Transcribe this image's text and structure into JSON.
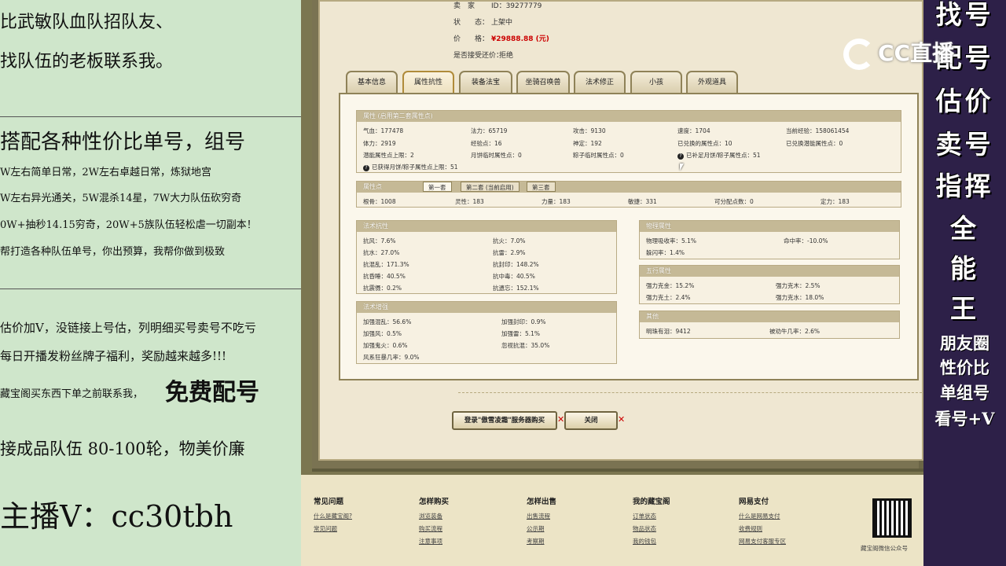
{
  "left": {
    "lines": [
      "比武敏队血队招队友、",
      "找队伍的老板联系我。",
      "搭配各种性价比单号，组号",
      "W左右简单日常，2W左右卓越日常，炼狱地宫",
      "W左右异光通关，5W混杀14星，7W大力队伍砍穷奇",
      "0W+抽秒14.15穷奇，20W+5族队伍轻松虐一切副本！",
      "帮打造各种队伍单号，你出预算，我帮你做到极致",
      "估价加V，没链接上号估，列明细买号卖号不吃亏",
      "每日开播发粉丝牌子福利，奖励越来越多!!!",
      "藏宝阁买东西下单之前联系我，",
      "免费配号",
      "接成品队伍 80-100轮，物美价廉",
      "主播V：cc30tbh"
    ]
  },
  "info": {
    "seller_label": "卖　家",
    "seller_value": "ID：39277779",
    "status_label": "状　　态：",
    "status_value": "上架中",
    "price_label": "价　　格：",
    "price_value": "¥29888.88 (元)",
    "bargain_label": "是否接受还价：",
    "bargain_value": "拒绝"
  },
  "tabs": [
    "基本信息",
    "属性抗性",
    "装备法宝",
    "坐骑召唤兽",
    "法术修正",
    "小孩",
    "外观道具"
  ],
  "attr": {
    "title": "属性 (启用第二套属性点)",
    "cells": [
      "气血：177478",
      "法力：65719",
      "攻击：9130",
      "速度：1704",
      "当前经验：158061454",
      "体力：2919",
      "经验点：16",
      "神定：192",
      "已兑换的属性点：10",
      "已兑换潜能属性点：0",
      "潜能属性点上限：2",
      "月饼临时属性点：0",
      "粽子临时属性点：0",
      "已补足月饼/粽子属性点：51"
    ],
    "bottom": "已获得月饼/粽子属性点上限：51"
  },
  "points": {
    "title": "属性点",
    "subtabs": [
      "第一套",
      "第二套 (当前启用)",
      "第三套"
    ],
    "cells": [
      "根骨：1008",
      "灵性：183",
      "力量：183",
      "敏捷：331",
      "可分配点数：0",
      "定力：183"
    ]
  },
  "resist": {
    "title": "法术抗性",
    "cells": [
      "抗风：7.6%",
      "抗火：7.0%",
      "抗水：27.0%",
      "抗雷：2.9%",
      "抗混乱：171.3%",
      "抗封印：148.2%",
      "抗昏睡：40.5%",
      "抗中毒：40.5%",
      "抗震慑：0.2%",
      "抗遗忘：152.1%"
    ]
  },
  "enhance": {
    "title": "法术增强",
    "cells": [
      "加强混乱：56.6%",
      "加强封印：0.9%",
      "加强风：0.5%",
      "加强雷：5.1%",
      "加强鬼火：0.6%",
      "忽视抗混：35.0%",
      "风系狂暴几率：9.0%"
    ]
  },
  "physical": {
    "title": "物理属性",
    "cells": [
      "物理吸收率：5.1%",
      "命中率：-10.0%",
      "躲闪率：1.4%"
    ]
  },
  "wuxing": {
    "title": "五行属性",
    "cells": [
      "强力克金：15.2%",
      "强力克木：2.5%",
      "强力克土：2.4%",
      "强力克水：18.0%"
    ]
  },
  "other": {
    "title": "其他",
    "cells": [
      "明珠有泪：9412",
      "被劝牛几率：2.6%"
    ]
  },
  "buttons": {
    "login": "登录\"傲雪凌霜\"服务器购买",
    "close": "关闭"
  },
  "footer": {
    "columns": [
      {
        "title": "常见问题",
        "links": [
          "什么是藏宝阁?",
          "常见问题"
        ]
      },
      {
        "title": "怎样购买",
        "links": [
          "浏览装备",
          "购买流程",
          "注意事项"
        ]
      },
      {
        "title": "怎样出售",
        "links": [
          "出售流程",
          "公示期",
          "考察期"
        ]
      },
      {
        "title": "我的藏宝阁",
        "links": [
          "订单状态",
          "物品状态",
          "我的钱包"
        ]
      },
      {
        "title": "网易支付",
        "links": [
          "什么是网易支付",
          "收费规则",
          "网易支付客服专区"
        ]
      }
    ],
    "qr_label": "藏宝阁微信公众号"
  },
  "logo": "CC直播",
  "right": {
    "big": [
      "找号",
      "配号",
      "估价",
      "卖号",
      "指挥",
      "全",
      "能",
      "王"
    ],
    "small": [
      "朋友圈",
      "性价比",
      "单组号",
      "看号+V"
    ]
  }
}
